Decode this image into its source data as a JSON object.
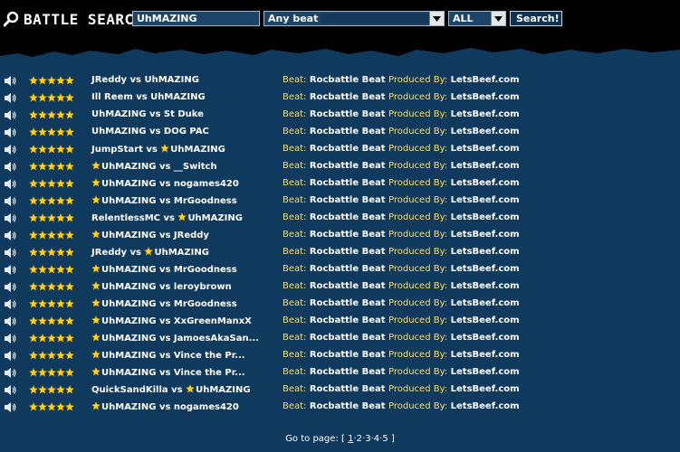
{
  "search": {
    "label": "BATTLE SEARCH:",
    "query": "UhMAZING",
    "beat_selected": "Any beat",
    "filter_selected": "ALL",
    "button_label": "Search!"
  },
  "results": [
    {
      "rating": 5,
      "star_prefix": false,
      "title": "JReddy vs UhMAZING",
      "title_parts": null,
      "beat_label": "Beat:",
      "beat": "Rocbattle Beat",
      "prod_label": "Produced By:",
      "producer": "LetsBeef.com"
    },
    {
      "rating": 5,
      "title": "Ill Reem vs UhMAZING",
      "beat_label": "Beat:",
      "beat": "Rocbattle Beat",
      "prod_label": "Produced By:",
      "producer": "LetsBeef.com"
    },
    {
      "rating": 5,
      "title": "UhMAZING vs St Duke",
      "beat_label": "Beat:",
      "beat": "Rocbattle Beat",
      "prod_label": "Produced By:",
      "producer": "LetsBeef.com"
    },
    {
      "rating": 5,
      "title": "UhMAZING vs DOG PAC",
      "beat_label": "Beat:",
      "beat": "Rocbattle Beat",
      "prod_label": "Produced By:",
      "producer": "LetsBeef.com"
    },
    {
      "rating": 5,
      "title_a": "JumpStart vs ",
      "title_b": "UhMAZING",
      "star_mid": true,
      "beat_label": "Beat:",
      "beat": "Rocbattle Beat",
      "prod_label": "Produced By:",
      "producer": "LetsBeef.com"
    },
    {
      "rating": 5,
      "star_prefix": true,
      "title": "UhMAZING vs __Switch",
      "beat_label": "Beat:",
      "beat": "Rocbattle Beat",
      "prod_label": "Produced By:",
      "producer": "LetsBeef.com"
    },
    {
      "rating": 5,
      "star_prefix": true,
      "title": "UhMAZING vs nogames420",
      "beat_label": "Beat:",
      "beat": "Rocbattle Beat",
      "prod_label": "Produced By:",
      "producer": "LetsBeef.com"
    },
    {
      "rating": 5,
      "star_prefix": true,
      "title": "UhMAZING vs MrGoodness",
      "beat_label": "Beat:",
      "beat": "Rocbattle Beat",
      "prod_label": "Produced By:",
      "producer": "LetsBeef.com"
    },
    {
      "rating": 5,
      "title_a": "RelentlessMC vs ",
      "title_b": "UhMAZING",
      "star_mid": true,
      "beat_label": "Beat:",
      "beat": "Rocbattle Beat",
      "prod_label": "Produced By:",
      "producer": "LetsBeef.com"
    },
    {
      "rating": 5,
      "star_prefix": true,
      "title": "UhMAZING vs JReddy",
      "beat_label": "Beat:",
      "beat": "Rocbattle Beat",
      "prod_label": "Produced By:",
      "producer": "LetsBeef.com"
    },
    {
      "rating": 5,
      "title_a": "JReddy vs ",
      "title_b": "UhMAZING",
      "star_mid": true,
      "beat_label": "Beat:",
      "beat": "Rocbattle Beat",
      "prod_label": "Produced By:",
      "producer": "LetsBeef.com"
    },
    {
      "rating": 5,
      "star_prefix": true,
      "title": "UhMAZING vs MrGoodness",
      "beat_label": "Beat:",
      "beat": "Rocbattle Beat",
      "prod_label": "Produced By:",
      "producer": "LetsBeef.com"
    },
    {
      "rating": 5,
      "star_prefix": true,
      "title": "UhMAZING vs leroybrown",
      "beat_label": "Beat:",
      "beat": "Rocbattle Beat",
      "prod_label": "Produced By:",
      "producer": "LetsBeef.com"
    },
    {
      "rating": 5,
      "star_prefix": true,
      "title": "UhMAZING vs MrGoodness",
      "beat_label": "Beat:",
      "beat": "Rocbattle Beat",
      "prod_label": "Produced By:",
      "producer": "LetsBeef.com"
    },
    {
      "rating": 5,
      "star_prefix": true,
      "title": "UhMAZING vs XxGreenManxX",
      "beat_label": "Beat:",
      "beat": "Rocbattle Beat",
      "prod_label": "Produced By:",
      "producer": "LetsBeef.com"
    },
    {
      "rating": 5,
      "star_prefix": true,
      "title": "UhMAZING vs JamoesAkaSan...",
      "beat_label": "Beat:",
      "beat": "Rocbattle Beat",
      "prod_label": "Produced By:",
      "producer": "LetsBeef.com"
    },
    {
      "rating": 5,
      "star_prefix": true,
      "title": "UhMAZING vs Vince the Pr...",
      "beat_label": "Beat:",
      "beat": "Rocbattle Beat",
      "prod_label": "Produced By:",
      "producer": "LetsBeef.com"
    },
    {
      "rating": 5,
      "star_prefix": true,
      "title": "UhMAZING vs Vince the Pr...",
      "beat_label": "Beat:",
      "beat": "Rocbattle Beat",
      "prod_label": "Produced By:",
      "producer": "LetsBeef.com"
    },
    {
      "rating": 5,
      "title_a": "QuickSandKilla vs ",
      "title_b": "UhMAZING",
      "star_mid": true,
      "beat_label": "Beat:",
      "beat": "Rocbattle Beat",
      "prod_label": "Produced By:",
      "producer": "LetsBeef.com"
    },
    {
      "rating": 5,
      "star_prefix": true,
      "title": "UhMAZING vs nogames420",
      "beat_label": "Beat:",
      "beat": "Rocbattle Beat",
      "prod_label": "Produced By:",
      "producer": "LetsBeef.com"
    }
  ],
  "pager": {
    "label": "Go to page:",
    "open": "[",
    "close": "]",
    "pages": [
      "1",
      "2",
      "3",
      "4",
      "5"
    ],
    "current": "1",
    "separator": "·"
  },
  "colors": {
    "background": "#0f3a5e",
    "topbar": "#000000",
    "star": "#ffd21a",
    "beat_label": "#ffde67"
  }
}
